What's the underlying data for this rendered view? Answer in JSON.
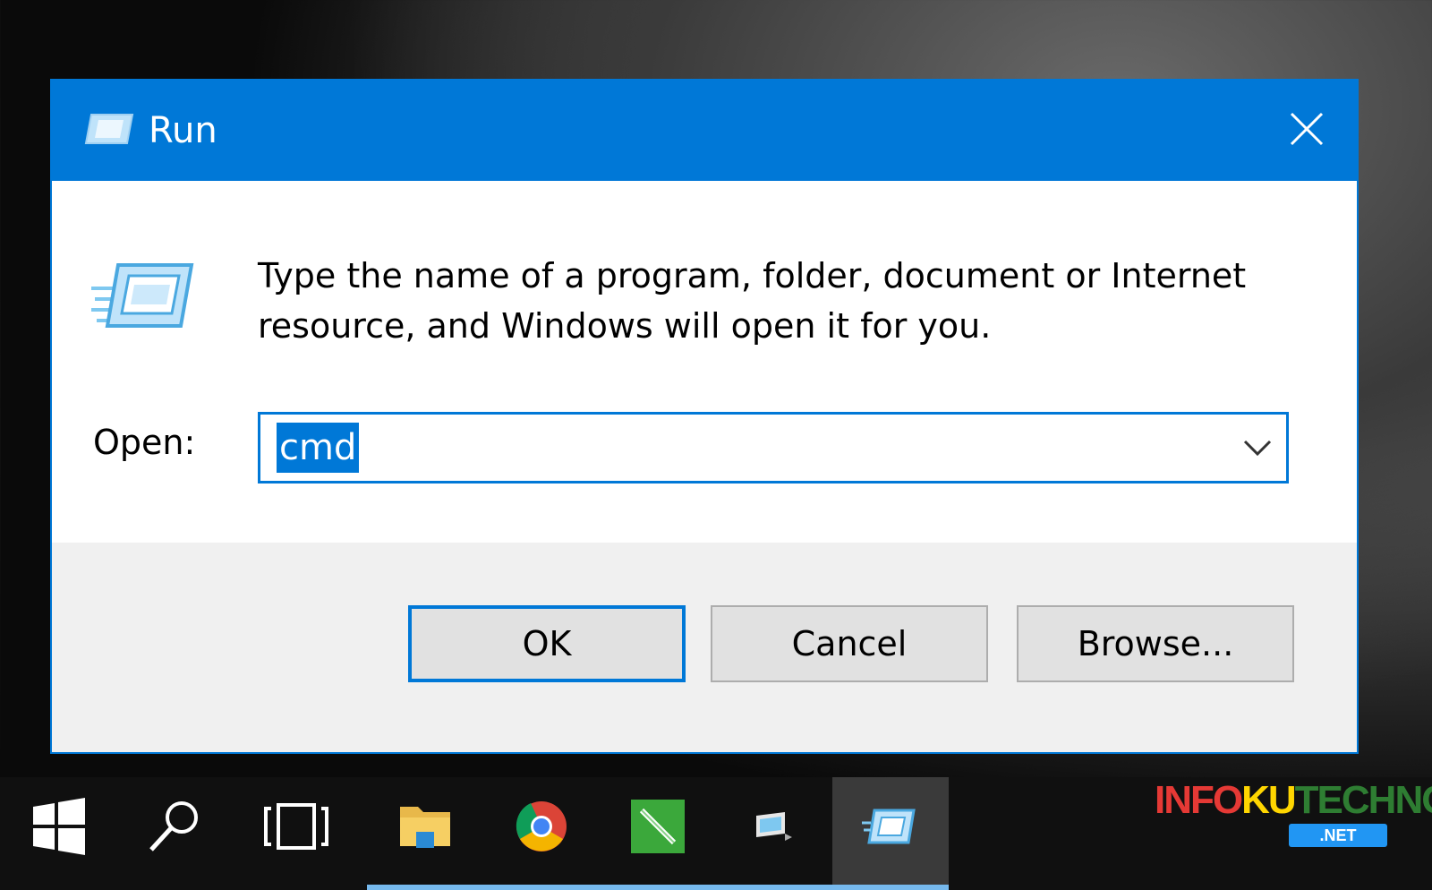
{
  "window": {
    "title": "Run",
    "title_icon": "run-icon",
    "close_icon": "close-icon"
  },
  "dialog": {
    "description": "Type the name of a program, folder, document or Internet resource, and Windows will open it for you.",
    "open_label": "Open:",
    "open_value": "cmd",
    "dropdown_icon": "chevron-down-icon"
  },
  "buttons": {
    "ok": "OK",
    "cancel": "Cancel",
    "browse": "Browse..."
  },
  "taskbar": {
    "items": [
      "windows-start-icon",
      "search-icon",
      "task-view-icon",
      "file-explorer-icon",
      "chrome-icon",
      "notepad-plus-icon",
      "app-icon",
      "run-icon"
    ]
  },
  "watermark": {
    "text": "INFOKUTECHNO",
    "subtext": ".NET"
  },
  "colors": {
    "accent": "#0078d7",
    "selection": "#0078d7",
    "button_face": "#e1e1e1",
    "footer_bg": "#f0f0f0"
  }
}
